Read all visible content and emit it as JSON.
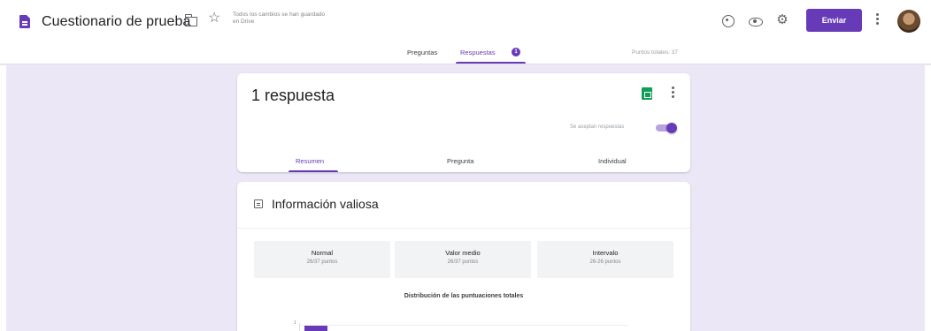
{
  "header": {
    "title": "Cuestionario de prueba",
    "save_status": "Todos los cambios se han guardado en Drive",
    "send_label": "Enviar",
    "icons": [
      "forms-doc-icon",
      "folder-icon",
      "star-icon",
      "palette-icon",
      "eye-icon",
      "gear-icon",
      "more-vert-icon",
      "avatar"
    ]
  },
  "tabs": {
    "questions": "Preguntas",
    "responses": "Respuestas",
    "responses_badge": "1",
    "total_points": "Puntos totales: 37"
  },
  "summary_card": {
    "response_count": "1 respuesta",
    "accepting_label": "Se aceptan respuestas",
    "accepting": true,
    "subtabs": {
      "summary": "Resumen",
      "question": "Pregunta",
      "individual": "Individual"
    }
  },
  "insights_card": {
    "title": "Información valiosa",
    "stats": [
      {
        "label": "Normal",
        "value": "26/37 puntos"
      },
      {
        "label": "Valor medio",
        "value": "26/37 puntos"
      },
      {
        "label": "Intervalo",
        "value": "26-26 puntos"
      }
    ],
    "distribution_title": "Distribución de las puntuaciones totales",
    "axis_tick": "1"
  },
  "colors": {
    "accent": "#673ab7",
    "background": "#ece7f7",
    "sheets": "#0f9d58"
  }
}
